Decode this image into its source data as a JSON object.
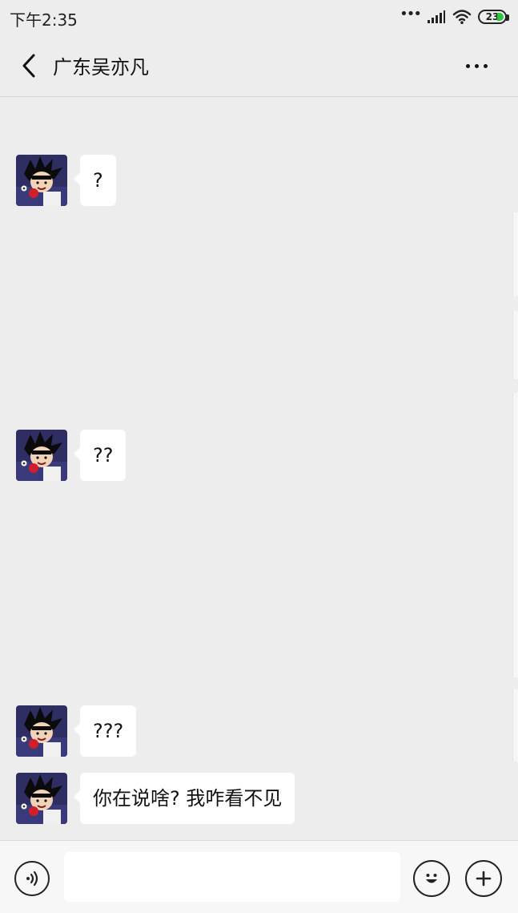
{
  "status_bar": {
    "time": "下午2:35",
    "battery_level": "23",
    "icons": [
      "more-dots-icon",
      "signal-icon",
      "wifi-icon",
      "battery-icon"
    ]
  },
  "header": {
    "title": "广东吴亦凡",
    "back_icon": "chevron-left-icon",
    "more_icon": "more-horizontal-icon"
  },
  "messages": [
    {
      "text": "?",
      "avatar": "goku-avatar"
    },
    {
      "text": "??",
      "avatar": "goku-avatar"
    },
    {
      "text": "???",
      "avatar": "goku-avatar"
    },
    {
      "text": "你在说啥? 我咋看不见",
      "avatar": "goku-avatar"
    }
  ],
  "input_bar": {
    "voice_icon": "voice-icon",
    "message_value": "",
    "message_placeholder": "",
    "emoji_icon": "smile-emoji-icon",
    "plus_icon": "plus-icon"
  },
  "colors": {
    "background": "#ededed",
    "bubble": "#ffffff",
    "battery_fill": "#2bc640"
  }
}
